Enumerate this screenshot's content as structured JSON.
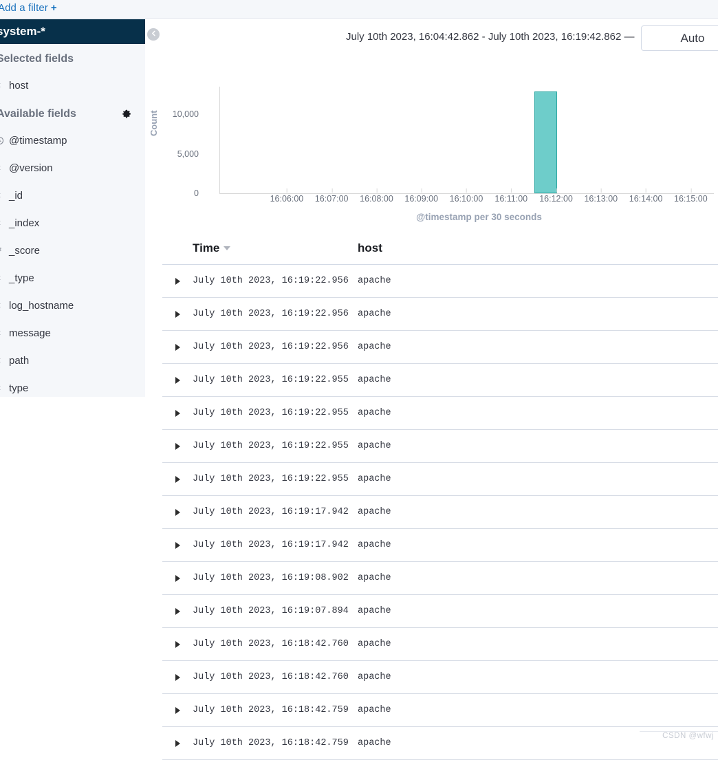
{
  "filter_bar": {
    "add_filter_label": "Add a filter",
    "add_filter_plus": "+"
  },
  "sidebar": {
    "index_pattern": "system-*",
    "selected_fields_label": "Selected fields",
    "selected_fields": [
      {
        "name": "host",
        "type_icon": "text-field-icon"
      }
    ],
    "available_fields_label": "Available fields",
    "settings_icon": "gear-icon",
    "available_fields": [
      {
        "name": "@timestamp",
        "type_icon": "clock-icon"
      },
      {
        "name": "@version",
        "type_icon": "text-field-icon"
      },
      {
        "name": "_id",
        "type_icon": "text-field-icon"
      },
      {
        "name": "_index",
        "type_icon": "text-field-icon"
      },
      {
        "name": "_score",
        "type_icon": "number-field-icon"
      },
      {
        "name": "_type",
        "type_icon": "text-field-icon"
      },
      {
        "name": "log_hostname",
        "type_icon": "text-field-icon"
      },
      {
        "name": "message",
        "type_icon": "text-field-icon"
      },
      {
        "name": "path",
        "type_icon": "text-field-icon"
      },
      {
        "name": "type",
        "type_icon": "text-field-icon"
      }
    ]
  },
  "collapse_button": {
    "icon": "chevron-left-icon"
  },
  "header": {
    "time_range": "July 10th 2023, 16:04:42.862 - July 10th 2023, 16:19:42.862 —",
    "interval_value": "Auto"
  },
  "chart_data": {
    "type": "bar",
    "title": "",
    "xlabel": "@timestamp per 30 seconds",
    "ylabel": "Count",
    "ylim": [
      0,
      13500
    ],
    "y_ticks": [
      0,
      5000,
      10000
    ],
    "y_tick_labels": [
      "0",
      "5,000",
      "10,000"
    ],
    "x_tick_labels": [
      "16:06:00",
      "16:07:00",
      "16:08:00",
      "16:09:00",
      "16:10:00",
      "16:11:00",
      "16:12:00",
      "16:13:00",
      "16:14:00",
      "16:15:00"
    ],
    "x_range": [
      "16:04:30",
      "16:15:30"
    ],
    "bar_color": "#6ecdca",
    "bar_border_color": "#2ea8a3",
    "grid": false,
    "legend": "none",
    "bars": [
      {
        "x": "16:11:30",
        "value": 12900
      }
    ]
  },
  "doc_table": {
    "columns": [
      {
        "key": "time",
        "label": "Time",
        "sorted": true,
        "sort_icon": "sort-desc-caret-icon"
      },
      {
        "key": "host",
        "label": "host",
        "sorted": false
      }
    ],
    "expand_icon": "expand-row-caret-icon",
    "rows": [
      {
        "time": "July 10th 2023, 16:19:22.956",
        "host": "apache"
      },
      {
        "time": "July 10th 2023, 16:19:22.956",
        "host": "apache"
      },
      {
        "time": "July 10th 2023, 16:19:22.956",
        "host": "apache"
      },
      {
        "time": "July 10th 2023, 16:19:22.955",
        "host": "apache"
      },
      {
        "time": "July 10th 2023, 16:19:22.955",
        "host": "apache"
      },
      {
        "time": "July 10th 2023, 16:19:22.955",
        "host": "apache"
      },
      {
        "time": "July 10th 2023, 16:19:22.955",
        "host": "apache"
      },
      {
        "time": "July 10th 2023, 16:19:17.942",
        "host": "apache"
      },
      {
        "time": "July 10th 2023, 16:19:17.942",
        "host": "apache"
      },
      {
        "time": "July 10th 2023, 16:19:08.902",
        "host": "apache"
      },
      {
        "time": "July 10th 2023, 16:19:07.894",
        "host": "apache"
      },
      {
        "time": "July 10th 2023, 16:18:42.760",
        "host": "apache"
      },
      {
        "time": "July 10th 2023, 16:18:42.760",
        "host": "apache"
      },
      {
        "time": "July 10th 2023, 16:18:42.759",
        "host": "apache"
      },
      {
        "time": "July 10th 2023, 16:18:42.759",
        "host": "apache"
      }
    ]
  },
  "watermark": {
    "text": "CSDN @wfwj"
  }
}
